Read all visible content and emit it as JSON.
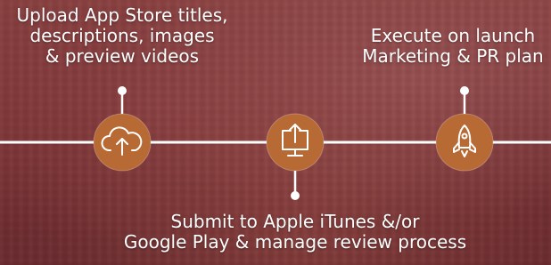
{
  "steps": [
    {
      "icon": "cloud-upload-icon",
      "lines": [
        "Upload App Store titles,",
        "descriptions, images",
        "& preview videos"
      ]
    },
    {
      "icon": "monitor-upload-icon",
      "lines": [
        "Submit to Apple iTunes &/or",
        "Google Play & manage review process"
      ]
    },
    {
      "icon": "rocket-icon",
      "lines": [
        "Execute on launch",
        "Marketing & PR plan"
      ]
    }
  ],
  "colors": {
    "node_fill": "#b86a35",
    "line": "#ffffff"
  }
}
